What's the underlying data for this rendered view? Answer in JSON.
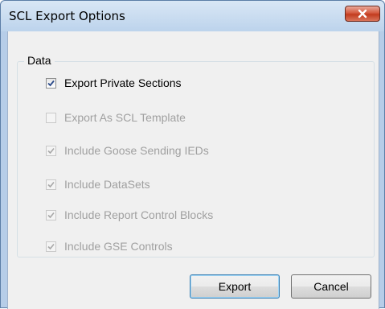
{
  "window": {
    "title": "SCL Export Options",
    "close_label": "close"
  },
  "group": {
    "legend": "Data"
  },
  "options": [
    {
      "label": "Export Private Sections",
      "checked": true,
      "enabled": true
    },
    {
      "label": "Export As SCL Template",
      "checked": false,
      "enabled": false
    },
    {
      "label": "Include Goose Sending IEDs",
      "checked": true,
      "enabled": false
    },
    {
      "label": "Include DataSets",
      "checked": true,
      "enabled": false
    },
    {
      "label": "Include Report Control Blocks",
      "checked": true,
      "enabled": false
    },
    {
      "label": "Include GSE Controls",
      "checked": true,
      "enabled": false
    }
  ],
  "buttons": {
    "export_label": "Export",
    "cancel_label": "Cancel"
  },
  "colors": {
    "checkmark_enabled": "#2a4a8a",
    "checkmark_disabled": "#a8a8a8",
    "disabled_text": "#a0a0a0"
  }
}
